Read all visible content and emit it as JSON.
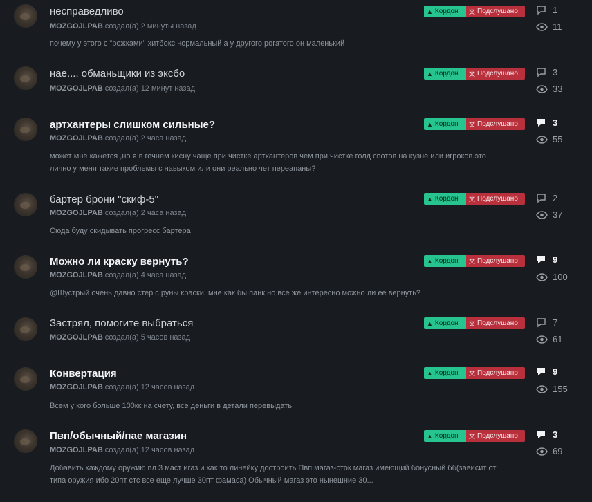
{
  "topics": [
    {
      "title": "несправедливо",
      "bold": false,
      "author": "MOZGOJLPAB",
      "created": "создал(а)",
      "time": "2 минуты назад",
      "excerpt": "почему у этого с \"рожками\" хитбокс нормальный а у другого рогатого он маленький",
      "tag1": "Кордон",
      "tag2": "Подслушано",
      "replies": "1",
      "views": "11"
    },
    {
      "title": "нае.... обманьщики из эксбо",
      "bold": false,
      "author": "MOZGOJLPAB",
      "created": "создал(а)",
      "time": "12 минут назад",
      "excerpt": "",
      "tag1": "Кордон",
      "tag2": "Подслушано",
      "replies": "3",
      "views": "33"
    },
    {
      "title": "артхантеры слишком сильные?",
      "bold": true,
      "author": "MOZGOJLPAB",
      "created": "создал(а)",
      "time": "2 часа назад",
      "excerpt": "может мне кажется ,но я в гочнем кисну чаще при чистке артхантеров чем при чистке голд спотов на кузне или игроков.это лично у меня такие проблемы с навыком или они реально чет переапаны?",
      "tag1": "Кордон",
      "tag2": "Подслушано",
      "replies": "3",
      "views": "55"
    },
    {
      "title": "бартер брони \"скиф-5\"",
      "bold": false,
      "author": "MOZGOJLPAB",
      "created": "создал(а)",
      "time": "2 часа назад",
      "excerpt": "Сюда буду скидывать прогресс бартера",
      "tag1": "Кордон",
      "tag2": "Подслушано",
      "replies": "2",
      "views": "37"
    },
    {
      "title": "Можно ли краску вернуть?",
      "bold": true,
      "author": "MOZGOJLPAB",
      "created": "создал(а)",
      "time": "4 часа назад",
      "excerpt": "@Шустрый очень давно стер с руны краски, мне как бы панк но все же интересно можно ли ее вернуть?",
      "tag1": "Кордон",
      "tag2": "Подслушано",
      "replies": "9",
      "views": "100"
    },
    {
      "title": "Застрял, помогите выбраться",
      "bold": false,
      "author": "MOZGOJLPAB",
      "created": "создал(а)",
      "time": "5 часов назад",
      "excerpt": "",
      "tag1": "Кордон",
      "tag2": "Подслушано",
      "replies": "7",
      "views": "61"
    },
    {
      "title": "Конвертация",
      "bold": true,
      "author": "MOZGOJLPAB",
      "created": "создал(а)",
      "time": "12 часов назад",
      "excerpt": "Всем у кого больше 100кк на счету, все деньги в детали перевыдать",
      "tag1": "Кордон",
      "tag2": "Подслушано",
      "replies": "9",
      "views": "155"
    },
    {
      "title": "Пвп/обычный/пае магазин",
      "bold": true,
      "author": "MOZGOJLPAB",
      "created": "создал(а)",
      "time": "12 часов назад",
      "excerpt": "Добавить каждому оружию пл 3 маст игаз и как то линейку достроить Пвп магаз-сток магаз имеющий бонусный бб(зависит от типа оружия ибо 20пт стс все еще лучше 30пт фамаса) Обычный магаз это нынешние 30...",
      "tag1": "Кордон",
      "tag2": "Подслушано",
      "replies": "3",
      "views": "69"
    }
  ],
  "icons": {
    "reply": "speech-bubble-icon",
    "views": "eye-icon",
    "tag1": "turtle-icon",
    "tag2": "translate-icon"
  },
  "colors": {
    "background": "#181c21",
    "tag_kordon": "#27c48f",
    "tag_podslushano": "#b8303c"
  }
}
